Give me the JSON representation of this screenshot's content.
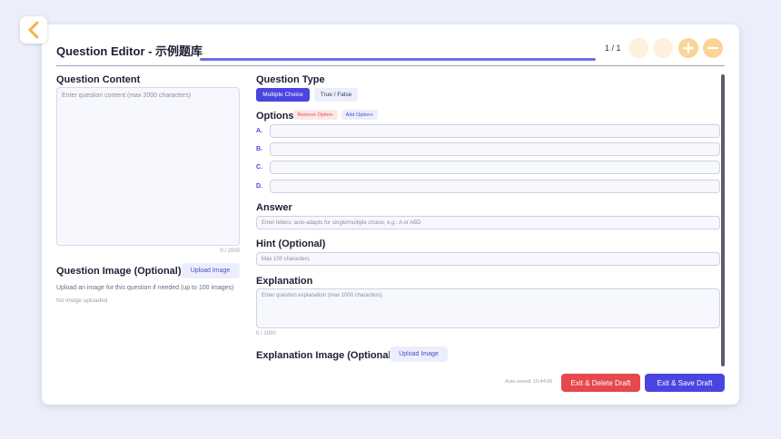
{
  "header": {
    "title": "Question Editor - 示例题库",
    "counter": "1 / 1",
    "progress": 1.0,
    "buttons": [
      "prev-question-icon",
      "next-question-icon",
      "plus-icon",
      "minus-icon"
    ]
  },
  "left": {
    "content_label": "Question Content",
    "content_placeholder": "Enter question content (max 2000 characters)",
    "content_count": "0 / 2000",
    "image_label": "Question Image (Optional)",
    "upload_label": "Upload Image",
    "image_helper": "Upload an image for this question if needed (up to 100 images)",
    "no_image": "No image uploaded"
  },
  "right": {
    "type_label": "Question Type",
    "type_options": [
      "Multiple Choice",
      "True / False"
    ],
    "type_selected": "Multiple Choice",
    "options_label": "Options",
    "remove_option": "Remove Option-",
    "add_option": "Add Option+",
    "options": [
      {
        "letter": "A.",
        "value": ""
      },
      {
        "letter": "B.",
        "value": ""
      },
      {
        "letter": "C.",
        "value": ""
      },
      {
        "letter": "D.",
        "value": ""
      }
    ],
    "answer_label": "Answer",
    "answer_placeholder": "Enter letters; auto-adapts for single/multiple choice, e.g.: A or ABD",
    "hint_label": "Hint (Optional)",
    "hint_placeholder": "Max 100 characters",
    "explanation_label": "Explanation",
    "explanation_placeholder": "Enter question explanation (max 1000 characters)",
    "explanation_count": "0 / 1000",
    "explanation_image_label": "Explanation Image (Optional)",
    "upload_label": "Upload Image"
  },
  "footer": {
    "autosave": "Auto-saved: 10:44:06",
    "delete_label": "Exit & Delete Draft",
    "save_label": "Exit & Save Draft"
  },
  "colors": {
    "accent": "#4a45e0",
    "danger": "#e5484d",
    "header_button": "#fad597",
    "back_chevron": "#f2b34a"
  }
}
